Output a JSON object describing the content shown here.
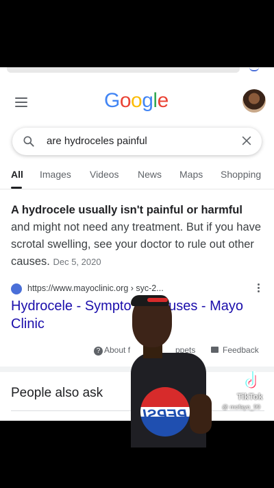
{
  "header": {
    "logo_letters": [
      {
        "char": "G",
        "color": "#4285F4"
      },
      {
        "char": "o",
        "color": "#EA4335"
      },
      {
        "char": "o",
        "color": "#FBBC05"
      },
      {
        "char": "g",
        "color": "#4285F4"
      },
      {
        "char": "l",
        "color": "#34A853"
      },
      {
        "char": "e",
        "color": "#EA4335"
      }
    ]
  },
  "search": {
    "query": "are hydroceles painful"
  },
  "tabs": [
    "All",
    "Images",
    "Videos",
    "News",
    "Maps",
    "Shopping"
  ],
  "featured_snippet": {
    "bold_text": "A hydrocele usually isn't painful or harmful",
    "rest_text": " and might not need any treatment. But if you have scrotal swelling, see your doctor to rule out other causes.",
    "date": "Dec 5, 2020"
  },
  "result": {
    "url": "https://www.mayoclinic.org › syc-2...",
    "title": "Hydrocele - Sympto    nd causes - Mayo Clinic"
  },
  "footer": {
    "about": "About f",
    "snippets": "ppets",
    "feedback": "Feedback"
  },
  "people_also_ask": "People also ask",
  "overlay": {
    "shirt_brand": "PEPSI",
    "tiktok_label": "TikTok",
    "tiktok_user": "@ mofayo_99"
  }
}
